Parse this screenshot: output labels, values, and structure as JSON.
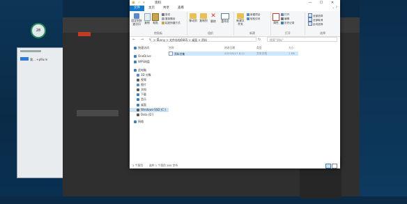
{
  "desktop": {
    "clock_widget": "28",
    "mini_window_text": "我… +p9a.m"
  },
  "background_app": {
    "left_list": [
      "",
      "",
      "",
      "",
      "",
      "",
      "",
      "",
      "",
      "",
      "",
      "",
      "",
      "",
      "",
      "",
      "",
      "",
      "",
      "",
      "",
      "",
      "",
      "",
      "",
      ""
    ]
  },
  "window": {
    "title": "资料",
    "controls": [
      "—",
      "☐",
      "✕"
    ]
  },
  "ribbon": {
    "tabs": [
      "文件",
      "主页",
      "共享",
      "查看"
    ],
    "groups": {
      "clipboard": {
        "label": "剪贴板",
        "pin": "固定到快速访问",
        "copy": "复制",
        "paste": "粘贴",
        "cut": "剪切",
        "copy_path": "复制路径",
        "paste_shortcut": "粘贴快捷方式"
      },
      "organize": {
        "label": "组织",
        "move_to": "移动到",
        "copy_to": "复制到",
        "delete": "删除",
        "rename": "重命名"
      },
      "new": {
        "label": "新建",
        "new_folder": "新建文件夹",
        "new_item": "新建项目",
        "easy_access": "轻松访问"
      },
      "open": {
        "label": "打开",
        "properties": "属性",
        "open": "打开",
        "edit": "编辑",
        "history": "历史记录"
      },
      "select": {
        "label": "选择",
        "select_all": "全部选择",
        "select_none": "全部取消",
        "invert": "反向选择"
      }
    }
  },
  "address_bar": {
    "nav": "← → ∨ ↑",
    "path": "> Sunny > 文件存档6665 > 桌面 > 资料",
    "search_placeholder": "搜索\"资料\""
  },
  "nav_pane": {
    "items": [
      {
        "label": "快速访问",
        "color": "#3a80c0"
      },
      {
        "label": "OneDrive",
        "color": "#3a80c0"
      },
      {
        "label": "WPS网盘",
        "color": "#3a80c0"
      },
      {
        "label": "此电脑",
        "color": "#3a80c0"
      },
      {
        "label": "3D 对象",
        "color": "#5a89c8"
      },
      {
        "label": "视频",
        "color": "#5a5a5a"
      },
      {
        "label": "图片",
        "color": "#5a89c8"
      },
      {
        "label": "文档",
        "color": "#5a5a5a"
      },
      {
        "label": "下载",
        "color": "#3a80c0"
      },
      {
        "label": "音乐",
        "color": "#3a80c0"
      },
      {
        "label": "桌面",
        "color": "#3a80c0"
      },
      {
        "label": "Windows-SSD (C:)",
        "color": "#5a5a5a"
      },
      {
        "label": "Data (D:)",
        "color": "#5a5a5a"
      },
      {
        "label": "网络",
        "color": "#3a80c0"
      }
    ]
  },
  "content": {
    "columns": [
      "名称",
      "修改日期",
      "类型",
      "大小"
    ],
    "files": [
      {
        "name": "资料合集",
        "modified": "2023/9/17 8:11",
        "type": "文本文档",
        "size": "1 KB"
      }
    ]
  },
  "status_bar": {
    "count": "1 个项目",
    "selected": "选中 1 个项目 285 字节"
  }
}
